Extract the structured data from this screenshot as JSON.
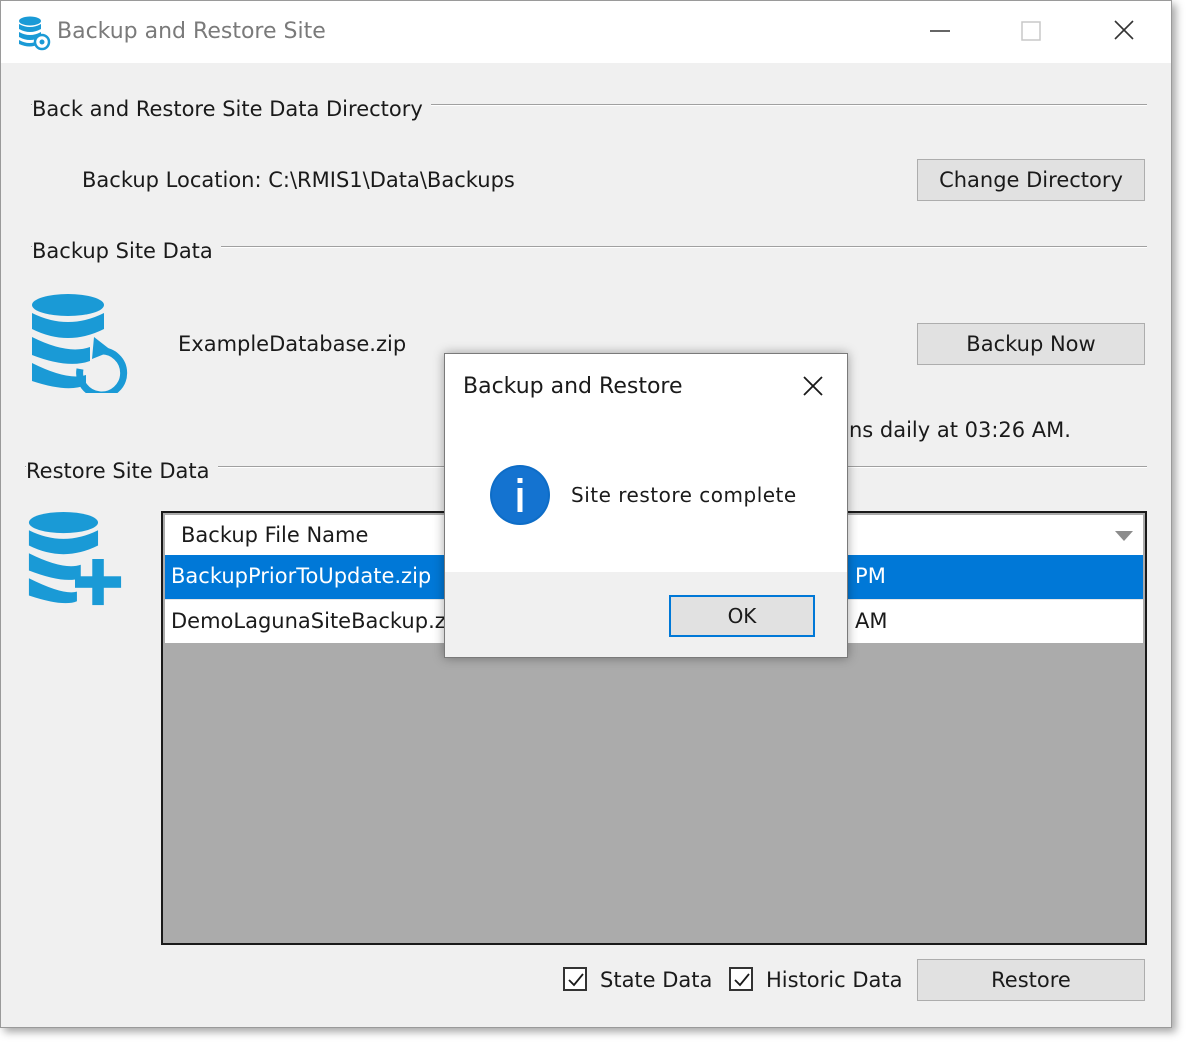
{
  "window": {
    "title": "Backup and Restore Site",
    "controls": {
      "minimize": "minimize-icon",
      "maximize": "maximize-icon",
      "close": "close-icon"
    }
  },
  "directory_section": {
    "label": "Back and Restore Site Data Directory",
    "location_label": "Backup Location: C:\\RMIS1\\Data\\Backups",
    "change_button": "Change Directory"
  },
  "backup_section": {
    "label": "Backup Site Data",
    "icon": "database-backup-icon",
    "file_name": "ExampleDatabase.zip",
    "backup_button": "Backup Now",
    "schedule_text": "runs daily at 03:26 AM."
  },
  "restore_section": {
    "label": "Restore Site Data",
    "icon": "database-add-icon",
    "column_header": "Backup File Name",
    "rows": [
      {
        "name": "BackupPriorToUpdate.zip",
        "date": "1 PM",
        "selected": true
      },
      {
        "name": "DemoLagunaSiteBackup.zip",
        "date": "1 AM",
        "selected": false
      }
    ],
    "state_data_label": "State Data",
    "state_data_checked": true,
    "historic_data_label": "Historic Data",
    "historic_data_checked": true,
    "restore_button": "Restore"
  },
  "dialog": {
    "title": "Backup and Restore",
    "message": "Site restore complete",
    "icon": "info-icon",
    "ok_button": "OK"
  },
  "colors": {
    "selection": "#0078d7",
    "icon_blue": "#1a9ad6",
    "list_background": "#ababab"
  }
}
